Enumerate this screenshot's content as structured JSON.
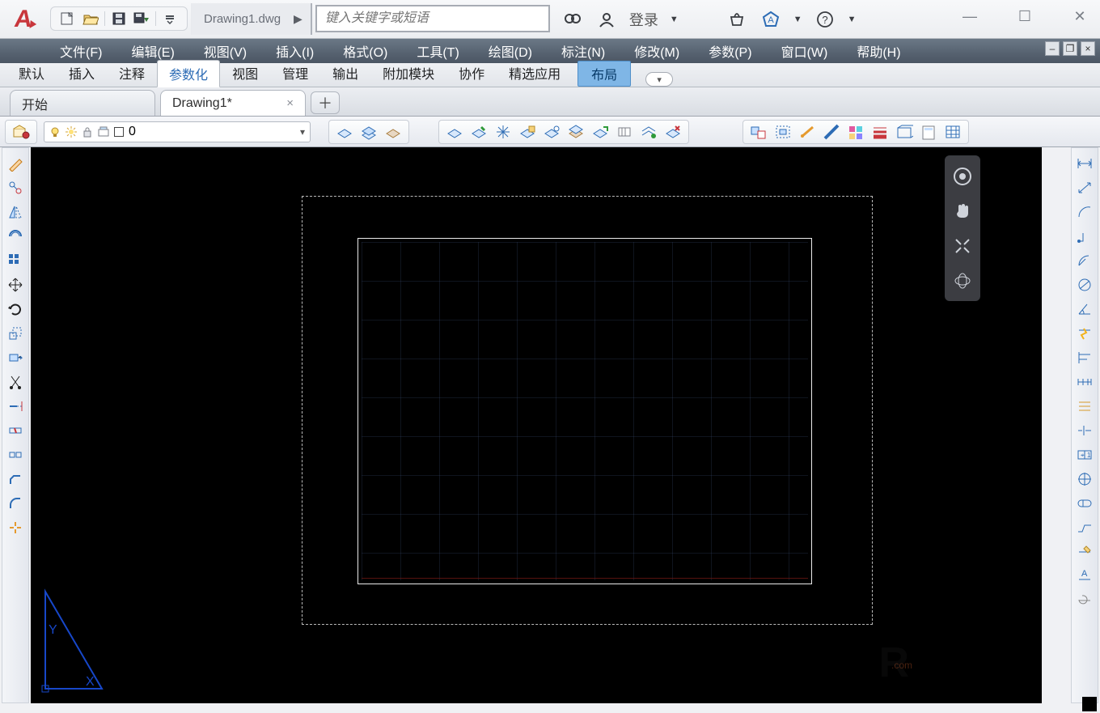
{
  "titlebar": {
    "document": "Drawing1.dwg",
    "search_placeholder": "键入关键字或短语",
    "login": "登录"
  },
  "quick_access": {
    "new": "新建",
    "open": "打开",
    "save": "保存",
    "saveas": "另存",
    "more": "更多"
  },
  "menu": {
    "file": "文件(F)",
    "edit": "编辑(E)",
    "view": "视图(V)",
    "insert": "插入(I)",
    "format": "格式(O)",
    "tools": "工具(T)",
    "draw": "绘图(D)",
    "dimension": "标注(N)",
    "modify": "修改(M)",
    "parametric": "参数(P)",
    "window": "窗口(W)",
    "help": "帮助(H)"
  },
  "ribbon": {
    "default": "默认",
    "insert": "插入",
    "annotate": "注释",
    "parametric": "参数化",
    "view": "视图",
    "manage": "管理",
    "output": "输出",
    "addins": "附加模块",
    "collaborate": "协作",
    "featured": "精选应用",
    "layout": "布局"
  },
  "doctabs": {
    "start": "开始",
    "drawing": "Drawing1*"
  },
  "layer": {
    "current": "0"
  },
  "wm": {
    "com": ".com"
  }
}
